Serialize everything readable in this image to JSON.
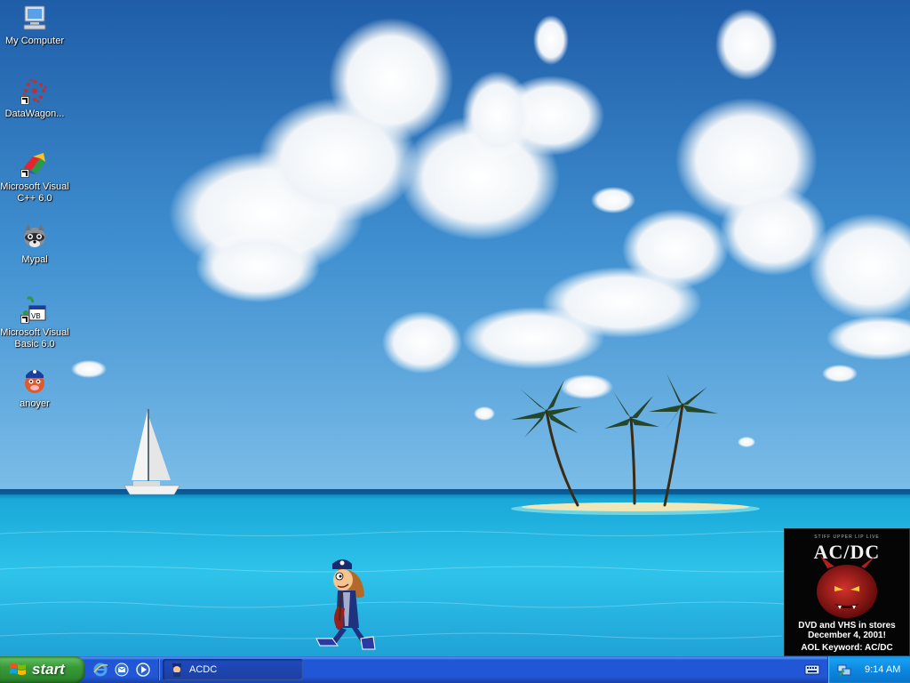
{
  "desktop": {
    "icons": [
      {
        "label": "My Computer",
        "icon": "my-computer-icon"
      },
      {
        "label": "DataWagon...",
        "icon": "datawagon-icon"
      },
      {
        "label": "Microsoft Visual\nC++ 6.0",
        "icon": "visual-cpp-icon"
      },
      {
        "label": "Mypal",
        "icon": "mypal-icon"
      },
      {
        "label": "Microsoft Visual\nBasic 6.0",
        "icon": "visual-basic-icon"
      },
      {
        "label": "anoyer",
        "icon": "anoyer-icon"
      }
    ],
    "wallpaper": "tropical-island-wallpaper"
  },
  "ad_popup": {
    "tagline": "STIFF UPPER LIP LIVE",
    "band": "AC/DC",
    "line1": "DVD and VHS in stores",
    "line2": "December 4, 2001!",
    "keyword": "AOL Keyword: AC/DC"
  },
  "taskbar": {
    "start_label": "start",
    "quick_launch": [
      "internet-explorer-icon",
      "outlook-express-icon",
      "media-player-icon"
    ],
    "tasks": [
      {
        "label": "ACDC",
        "active": true
      }
    ],
    "clock": "9:14 AM"
  },
  "colors": {
    "taskbar_blue": "#2157d7",
    "start_green": "#3a9a3a",
    "tray_blue": "#0c88e2"
  }
}
